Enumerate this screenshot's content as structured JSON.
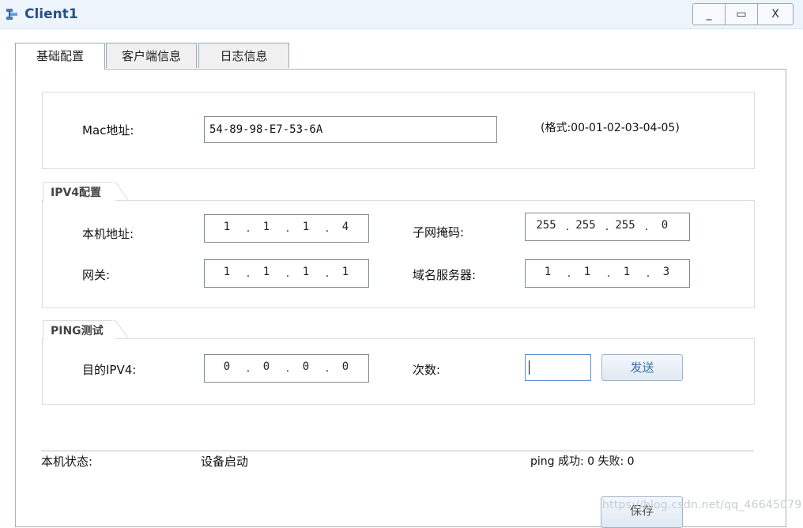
{
  "window": {
    "title": "Client1",
    "min_glyph": "_",
    "max_glyph": "▭",
    "close_glyph": "X"
  },
  "tabs": [
    {
      "label": "基础配置",
      "active": true
    },
    {
      "label": "客户端信息",
      "active": false
    },
    {
      "label": "日志信息",
      "active": false
    }
  ],
  "mac": {
    "label": "Mac地址:",
    "value": "54-89-98-E7-53-6A",
    "hint": "(格式:00-01-02-03-04-05)"
  },
  "ipv4": {
    "legend": "IPV4配置",
    "local_ip": {
      "label": "本机地址:",
      "octets": [
        "1",
        "1",
        "1",
        "4"
      ]
    },
    "mask": {
      "label": "子网掩码:",
      "octets": [
        "255",
        "255",
        "255",
        "0"
      ]
    },
    "gateway": {
      "label": "网关:",
      "octets": [
        "1",
        "1",
        "1",
        "1"
      ]
    },
    "dns": {
      "label": "域名服务器:",
      "octets": [
        "1",
        "1",
        "1",
        "3"
      ]
    }
  },
  "ping": {
    "legend": "PING测试",
    "dest": {
      "label": "目的IPV4:",
      "octets": [
        "0",
        "0",
        "0",
        "0"
      ]
    },
    "count": {
      "label": "次数:",
      "value": ""
    },
    "send_label": "发送"
  },
  "status": {
    "label": "本机状态:",
    "value": "设备启动",
    "ping_result": "ping 成功: 0 失败: 0"
  },
  "save_label": "保存",
  "watermark": "https://blog.csdn.net/qq_46645079"
}
